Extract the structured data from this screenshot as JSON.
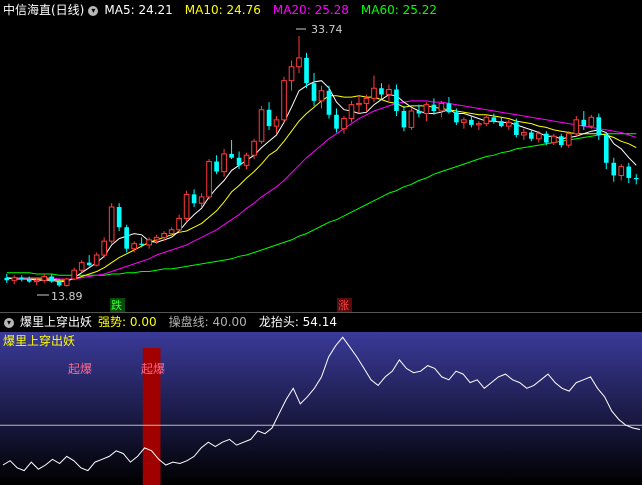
{
  "main": {
    "title": "中信海直(日线)",
    "ma": [
      {
        "label": "MA5: ",
        "value": "24.21",
        "color": "#ffffff"
      },
      {
        "label": "MA10: ",
        "value": "24.76",
        "color": "#ffff00"
      },
      {
        "label": "MA20: ",
        "value": "25.28",
        "color": "#ff00ff"
      },
      {
        "label": "MA60: ",
        "value": "25.22",
        "color": "#00ff00"
      }
    ],
    "high_label": "33.74",
    "low_label": "13.89",
    "marker_down": "跌",
    "marker_up": "涨"
  },
  "indicator": {
    "title": "爆里上穿出妖",
    "items": [
      {
        "label": "强势: ",
        "value": "0.00",
        "color": "#ffff00"
      },
      {
        "label": "操盘线: ",
        "value": "40.00",
        "color": "#b0b0b0"
      },
      {
        "label": "龙抬头: ",
        "value": "54.14",
        "color": "#ffffff"
      }
    ],
    "panel_label": "爆里上穿出妖",
    "signal_1": "起爆",
    "signal_2": "起爆"
  },
  "colors": {
    "up": "#ff3b3b",
    "down": "#00ffff",
    "ma5": "#ffffff",
    "ma10": "#ffff00",
    "ma20": "#ff00ff",
    "ma60": "#00ff00"
  },
  "chart_data": [
    {
      "type": "candlestick",
      "title": "中信海直(日线)",
      "price_range": [
        13,
        35
      ],
      "annotations": [
        {
          "text": "33.74",
          "kind": "high"
        },
        {
          "text": "13.89",
          "kind": "low"
        }
      ],
      "candles": [
        [
          14.6,
          14.9,
          14.2,
          14.4
        ],
        [
          14.4,
          14.8,
          14.1,
          14.6
        ],
        [
          14.6,
          14.8,
          14.3,
          14.5
        ],
        [
          14.5,
          14.7,
          14.2,
          14.3
        ],
        [
          14.3,
          14.6,
          14.0,
          14.4
        ],
        [
          14.4,
          14.9,
          14.2,
          14.7
        ],
        [
          14.7,
          14.9,
          14.2,
          14.3
        ],
        [
          14.3,
          14.5,
          13.89,
          14.0
        ],
        [
          14.0,
          14.6,
          13.9,
          14.5
        ],
        [
          14.5,
          15.4,
          14.4,
          15.2
        ],
        [
          15.2,
          16.0,
          15.0,
          15.8
        ],
        [
          15.8,
          16.4,
          15.5,
          15.6
        ],
        [
          15.6,
          16.6,
          15.5,
          16.4
        ],
        [
          16.4,
          17.8,
          16.2,
          17.5
        ],
        [
          17.5,
          20.5,
          17.3,
          20.2
        ],
        [
          20.2,
          20.5,
          18.3,
          18.6
        ],
        [
          18.6,
          18.8,
          16.6,
          16.9
        ],
        [
          16.9,
          17.5,
          16.6,
          17.3
        ],
        [
          17.3,
          17.8,
          17.0,
          17.2
        ],
        [
          17.2,
          17.8,
          16.9,
          17.6
        ],
        [
          17.6,
          18.0,
          17.3,
          17.8
        ],
        [
          17.8,
          18.3,
          17.5,
          18.1
        ],
        [
          18.1,
          18.6,
          17.8,
          18.4
        ],
        [
          18.4,
          19.6,
          18.2,
          19.3
        ],
        [
          19.3,
          21.5,
          19.0,
          21.2
        ],
        [
          21.2,
          21.6,
          20.2,
          20.5
        ],
        [
          20.5,
          21.3,
          20.2,
          21.0
        ],
        [
          21.0,
          24.0,
          20.8,
          23.8
        ],
        [
          23.8,
          24.3,
          22.8,
          23.0
        ],
        [
          23.0,
          24.8,
          22.6,
          24.4
        ],
        [
          24.4,
          25.5,
          24.0,
          24.1
        ],
        [
          24.1,
          24.6,
          23.2,
          23.5
        ],
        [
          23.5,
          24.5,
          23.2,
          24.3
        ],
        [
          24.3,
          25.6,
          24.0,
          25.4
        ],
        [
          25.4,
          28.2,
          25.2,
          27.9
        ],
        [
          27.9,
          28.5,
          26.3,
          26.6
        ],
        [
          26.6,
          27.4,
          26.0,
          27.1
        ],
        [
          27.1,
          30.5,
          26.9,
          30.2
        ],
        [
          30.2,
          31.8,
          29.4,
          31.3
        ],
        [
          31.3,
          33.74,
          30.8,
          32.0
        ],
        [
          32.0,
          32.4,
          29.6,
          30.0
        ],
        [
          30.0,
          30.8,
          28.2,
          28.6
        ],
        [
          28.6,
          29.8,
          28.0,
          29.4
        ],
        [
          29.4,
          29.8,
          27.2,
          27.5
        ],
        [
          27.5,
          28.0,
          26.1,
          26.4
        ],
        [
          26.4,
          27.4,
          26.0,
          27.2
        ],
        [
          27.2,
          28.6,
          26.9,
          28.3
        ],
        [
          28.3,
          29.0,
          27.6,
          28.4
        ],
        [
          28.4,
          29.1,
          27.8,
          28.8
        ],
        [
          28.8,
          30.6,
          28.5,
          29.6
        ],
        [
          29.6,
          30.0,
          28.7,
          29.1
        ],
        [
          29.1,
          29.9,
          28.6,
          29.5
        ],
        [
          29.5,
          29.9,
          27.4,
          27.8
        ],
        [
          27.8,
          28.2,
          26.2,
          26.5
        ],
        [
          26.5,
          28.0,
          26.3,
          27.8
        ],
        [
          27.8,
          28.3,
          27.3,
          27.6
        ],
        [
          27.6,
          28.5,
          27.0,
          28.3
        ],
        [
          28.3,
          28.8,
          27.5,
          27.8
        ],
        [
          27.8,
          28.6,
          27.3,
          28.4
        ],
        [
          28.4,
          28.9,
          27.6,
          27.7
        ],
        [
          27.7,
          28.0,
          26.7,
          26.9
        ],
        [
          26.9,
          27.3,
          26.4,
          27.1
        ],
        [
          27.1,
          27.4,
          26.5,
          26.7
        ],
        [
          26.7,
          27.0,
          26.3,
          26.8
        ],
        [
          26.8,
          27.5,
          26.6,
          27.3
        ],
        [
          27.3,
          27.6,
          26.8,
          27.0
        ],
        [
          27.0,
          27.3,
          26.5,
          26.6
        ],
        [
          26.6,
          27.1,
          26.3,
          26.9
        ],
        [
          26.9,
          27.2,
          25.7,
          25.9
        ],
        [
          25.9,
          26.4,
          25.5,
          26.1
        ],
        [
          26.1,
          26.3,
          25.4,
          25.6
        ],
        [
          25.6,
          26.2,
          25.3,
          26.0
        ],
        [
          26.0,
          26.2,
          25.1,
          25.3
        ],
        [
          25.3,
          26.0,
          25.1,
          25.8
        ],
        [
          25.8,
          26.0,
          24.9,
          25.1
        ],
        [
          25.1,
          26.2,
          24.9,
          26.0
        ],
        [
          26.0,
          27.4,
          25.8,
          27.1
        ],
        [
          27.1,
          27.8,
          26.3,
          26.6
        ],
        [
          26.6,
          27.5,
          26.4,
          27.3
        ],
        [
          27.3,
          27.6,
          25.5,
          25.9
        ],
        [
          25.9,
          26.1,
          23.2,
          23.7
        ],
        [
          23.7,
          24.1,
          22.2,
          22.7
        ],
        [
          22.7,
          23.6,
          22.3,
          23.4
        ],
        [
          23.4,
          23.7,
          22.1,
          22.5
        ],
        [
          22.5,
          22.8,
          22.0,
          22.4
        ]
      ],
      "ma5": [
        14.6,
        14.5,
        14.5,
        14.5,
        14.4,
        14.4,
        14.4,
        14.3,
        14.3,
        14.6,
        15.0,
        15.4,
        15.8,
        16.3,
        17.2,
        17.7,
        17.9,
        18.1,
        18.0,
        17.5,
        17.4,
        17.6,
        17.8,
        18.3,
        19.0,
        19.6,
        20.1,
        21.0,
        21.7,
        22.3,
        23.1,
        23.5,
        23.9,
        24.3,
        24.9,
        25.4,
        25.9,
        26.9,
        28.1,
        29.4,
        29.8,
        30.1,
        30.2,
        29.6,
        28.5,
        27.9,
        27.8,
        27.6,
        27.7,
        28.3,
        28.7,
        29.1,
        29.0,
        28.5,
        28.1,
        27.8,
        27.6,
        27.6,
        27.7,
        27.9,
        27.6,
        27.6,
        27.4,
        27.2,
        27.0,
        27.0,
        26.9,
        26.9,
        26.7,
        26.5,
        26.3,
        26.1,
        25.8,
        25.8,
        25.6,
        25.7,
        25.8,
        26.0,
        26.2,
        26.3,
        26.1,
        25.2,
        24.8,
        24.1,
        23.5
      ],
      "ma10": [
        14.6,
        14.5,
        14.5,
        14.5,
        14.5,
        14.5,
        14.5,
        14.4,
        14.4,
        14.5,
        14.7,
        14.9,
        15.1,
        15.4,
        15.8,
        16.2,
        16.5,
        16.8,
        17.1,
        17.4,
        17.6,
        17.8,
        18.0,
        18.2,
        18.3,
        18.6,
        18.9,
        19.4,
        19.9,
        20.6,
        21.4,
        21.9,
        22.5,
        23.0,
        23.6,
        24.3,
        24.7,
        25.4,
        26.2,
        27.0,
        27.6,
        28.1,
        28.6,
        29.0,
        29.0,
        28.9,
        28.9,
        29.0,
        28.9,
        28.9,
        28.7,
        28.5,
        28.4,
        28.1,
        28.2,
        28.2,
        28.2,
        28.1,
        28.0,
        27.9,
        27.8,
        27.7,
        27.6,
        27.5,
        27.5,
        27.4,
        27.3,
        27.2,
        27.0,
        26.9,
        26.8,
        26.6,
        26.5,
        26.3,
        26.2,
        26.1,
        26.0,
        26.0,
        26.0,
        26.0,
        25.9,
        25.7,
        25.4,
        25.2,
        24.9
      ],
      "ma20": [
        14.6,
        14.6,
        14.6,
        14.6,
        14.6,
        14.6,
        14.6,
        14.5,
        14.5,
        14.5,
        14.6,
        14.7,
        14.8,
        14.9,
        15.1,
        15.3,
        15.5,
        15.7,
        15.9,
        16.1,
        16.4,
        16.6,
        16.8,
        17.0,
        17.2,
        17.5,
        17.8,
        18.1,
        18.4,
        18.8,
        19.2,
        19.6,
        20.1,
        20.5,
        21.0,
        21.4,
        21.8,
        22.3,
        22.9,
        23.5,
        24.1,
        24.6,
        25.1,
        25.6,
        26.0,
        26.4,
        26.8,
        27.2,
        27.5,
        27.8,
        28.0,
        28.2,
        28.4,
        28.5,
        28.6,
        28.6,
        28.6,
        28.5,
        28.5,
        28.4,
        28.3,
        28.2,
        28.1,
        28.0,
        27.9,
        27.8,
        27.7,
        27.6,
        27.5,
        27.4,
        27.3,
        27.2,
        27.1,
        27.0,
        26.9,
        26.8,
        26.7,
        26.6,
        26.5,
        26.4,
        26.3,
        26.2,
        26.1,
        25.9,
        25.7
      ],
      "ma60": [
        15.0,
        15.0,
        15.0,
        15.0,
        14.9,
        14.9,
        14.9,
        14.8,
        14.8,
        14.8,
        14.8,
        14.8,
        14.8,
        14.8,
        14.9,
        14.9,
        15.0,
        15.0,
        15.1,
        15.1,
        15.2,
        15.3,
        15.3,
        15.4,
        15.5,
        15.6,
        15.7,
        15.8,
        15.9,
        16.0,
        16.1,
        16.3,
        16.4,
        16.6,
        16.8,
        17.0,
        17.2,
        17.4,
        17.6,
        17.9,
        18.1,
        18.4,
        18.7,
        19.0,
        19.2,
        19.5,
        19.8,
        20.1,
        20.4,
        20.7,
        21.0,
        21.3,
        21.5,
        21.8,
        22.0,
        22.3,
        22.5,
        22.8,
        23.0,
        23.2,
        23.4,
        23.6,
        23.8,
        24.0,
        24.2,
        24.3,
        24.5,
        24.6,
        24.8,
        24.9,
        25.0,
        25.1,
        25.2,
        25.3,
        25.4,
        25.5,
        25.6,
        25.7,
        25.8,
        25.9,
        26.0,
        26.0,
        26.0,
        26.0,
        26.0
      ]
    },
    {
      "type": "line",
      "title": "爆里上穿出妖",
      "y_range": [
        0,
        100
      ],
      "reference_line": 40,
      "signal_band_indices": [
        21
      ],
      "values": [
        12,
        15,
        10,
        8,
        14,
        9,
        12,
        16,
        13,
        18,
        15,
        10,
        8,
        14,
        16,
        18,
        22,
        20,
        14,
        18,
        24,
        22,
        16,
        12,
        14,
        13,
        15,
        18,
        24,
        28,
        25,
        28,
        30,
        26,
        28,
        30,
        36,
        34,
        38,
        48,
        58,
        66,
        55,
        60,
        66,
        74,
        88,
        96,
        102,
        95,
        88,
        80,
        72,
        68,
        74,
        78,
        86,
        80,
        77,
        78,
        82,
        80,
        74,
        72,
        78,
        76,
        70,
        72,
        66,
        70,
        74,
        76,
        72,
        70,
        66,
        68,
        72,
        76,
        70,
        66,
        64,
        70,
        72,
        74,
        66,
        60,
        50,
        44,
        40,
        38,
        37
      ]
    }
  ]
}
